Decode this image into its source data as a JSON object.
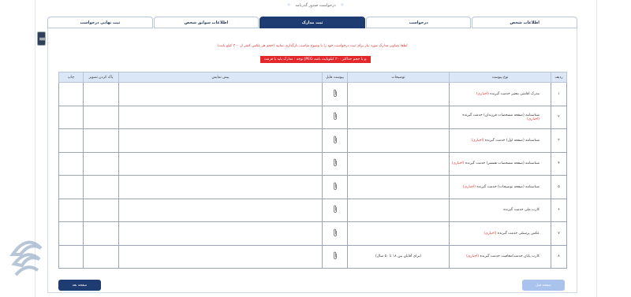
{
  "header": {
    "title": "درخواست صدور گذرنامه"
  },
  "tabs": [
    {
      "label": "اطلاعات شخص"
    },
    {
      "label": "درخواست"
    },
    {
      "label": "ثبت مدارک"
    },
    {
      "label": "اطلاعات سوابق شخص"
    },
    {
      "label": "ثبت نهایی درخواست"
    }
  ],
  "notices": {
    "line1": "لطفا تصاویر مدارک مورد نیاز برای ثبت درخواست خود را با وضوح مناسب بارگذاری نمایید (حجم هر عکس کمتر از ۳۰۰ کیلو بایت)",
    "line2": "توجه : مدارک باید با فرمت JPEG و با حجم حداکثر ۳۰۰ کیلوبایت باشد."
  },
  "table": {
    "headers": [
      "ردیف",
      "نوع پیوست",
      "توضیحات",
      "پیوست فایل",
      "پیش نمایش",
      "پاک کردن تصویر",
      "چاپ"
    ],
    "required_label": "(اجباری)",
    "rows": [
      {
        "num": "۱",
        "doc": "مدرک اقامتی معتبر خدمت گیرنده",
        "required": true,
        "desc": ""
      },
      {
        "num": "۲",
        "doc": "شناسنامه (صفحه مشخصات فرزندان) خدمت گیرنده",
        "required": true,
        "desc": ""
      },
      {
        "num": "۳",
        "doc": "شناسنامه (صفحه اول) خدمت گیرنده",
        "required": true,
        "desc": ""
      },
      {
        "num": "۴",
        "doc": "شناسنامه (صفحه مشخصات همسر) خدمت گیرنده",
        "required": true,
        "desc": ""
      },
      {
        "num": "۵",
        "doc": "شناسنامه (صفحه توضیحات) خدمت گیرنده",
        "required": true,
        "desc": ""
      },
      {
        "num": "۶",
        "doc": "کارت ملی خدمت گیرنده",
        "required": false,
        "desc": ""
      },
      {
        "num": "۷",
        "doc": "عکس پرسنلی خدمت گیرنده",
        "required": true,
        "desc": ""
      },
      {
        "num": "۸",
        "doc": "کارت پایان خدمت/معافیت خدمت گیرنده",
        "required": true,
        "desc": "(برای آقایان بین ۱۸ تا ۵۰ سال)"
      }
    ]
  },
  "buttons": {
    "next": "صفحه بعد",
    "prev": "صفحه قبل"
  },
  "colors": {
    "primary": "#1e3c72",
    "required": "#e03030",
    "header_bg": "#dbe6f6"
  }
}
